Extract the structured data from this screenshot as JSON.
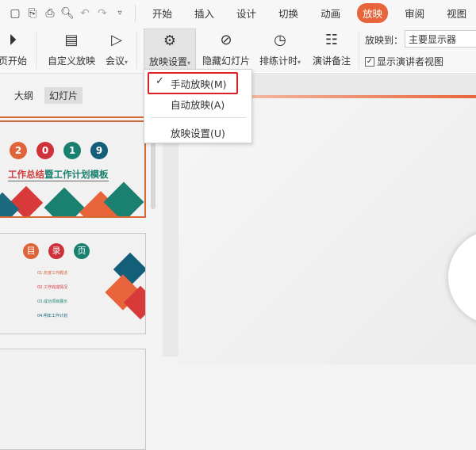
{
  "quick": {
    "icons": [
      "save-icon",
      "export-icon",
      "print-icon",
      "preview-icon",
      "undo-icon",
      "redo-icon",
      "customize-icon"
    ]
  },
  "tabs": [
    {
      "label": "开始"
    },
    {
      "label": "插入"
    },
    {
      "label": "设计"
    },
    {
      "label": "切换"
    },
    {
      "label": "动画"
    },
    {
      "label": "放映"
    },
    {
      "label": "审阅"
    },
    {
      "label": "视图"
    }
  ],
  "ribbon": {
    "from_current": "页开始",
    "custom_show": "自定义放映",
    "meeting": "会议",
    "show_settings": "放映设置",
    "hide_slide": "隐藏幻灯片",
    "rehearse": "排练计时",
    "notes": "演讲备注",
    "show_to_label": "放映到：",
    "show_to_value": "主要显示器",
    "presenter_view": "显示演讲者视图"
  },
  "menu": {
    "items": [
      {
        "label": "手动放映(M)",
        "checked": true
      },
      {
        "label": "自动放映(A)"
      },
      {
        "label": "放映设置(U)"
      }
    ]
  },
  "panel": {
    "tabs": [
      "大纲",
      "幻灯片"
    ]
  },
  "slides": [
    {
      "digits": [
        "2",
        "0",
        "1",
        "9"
      ],
      "title_a": "工作总结",
      "title_b": "暨工作计划模板"
    },
    {
      "chars": [
        "目",
        "录",
        "页"
      ],
      "items": [
        "01.年度工作概述",
        "02.工作完成情况",
        "03.成功项目展示",
        "04.明年工作计划"
      ]
    }
  ],
  "colors": {
    "accent": "#e8643a",
    "highlight": "#e02020"
  }
}
